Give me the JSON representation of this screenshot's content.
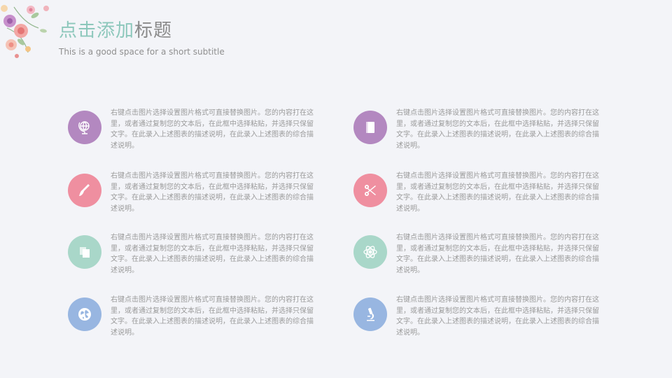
{
  "header": {
    "title_accent": "点击添加",
    "title_rest": "标题",
    "subtitle": "This is a good space for a short subtitle"
  },
  "colors": {
    "purple": "#b388c0",
    "pink": "#ef8fa0",
    "mint": "#a9d7c9",
    "blue": "#98b6e1",
    "title_accent": "#8cc7bb",
    "text": "#9a9a9a"
  },
  "items": [
    {
      "icon": "globe-stand-icon",
      "color": "purple",
      "text": "右键点击图片选择设置图片格式可直接替换图片。您的内容打在这里，或者通过复制您的文本后，在此框中选择粘贴，并选择只保留文字。在此录入上述图表的描述说明，在此录入上述图表的综合描述说明。"
    },
    {
      "icon": "book-icon",
      "color": "purple",
      "text": "右键点击图片选择设置图片格式可直接替换图片。您的内容打在这里，或者通过复制您的文本后，在此框中选择粘贴，并选择只保留文字。在此录入上述图表的描述说明，在此录入上述图表的综合描述说明。"
    },
    {
      "icon": "brush-icon",
      "color": "pink",
      "text": "右键点击图片选择设置图片格式可直接替换图片。您的内容打在这里，或者通过复制您的文本后，在此框中选择粘贴，并选择只保留文字。在此录入上述图表的描述说明，在此录入上述图表的综合描述说明。"
    },
    {
      "icon": "scissors-icon",
      "color": "pink",
      "text": "右键点击图片选择设置图片格式可直接替换图片。您的内容打在这里，或者通过复制您的文本后，在此框中选择粘贴，并选择只保留文字。在此录入上述图表的描述说明，在此录入上述图表的综合描述说明。"
    },
    {
      "icon": "documents-icon",
      "color": "mint",
      "text": "右键点击图片选择设置图片格式可直接替换图片。您的内容打在这里，或者通过复制您的文本后，在此框中选择粘贴，并选择只保留文字。在此录入上述图表的描述说明，在此录入上述图表的综合描述说明。"
    },
    {
      "icon": "atom-icon",
      "color": "mint",
      "text": "右键点击图片选择设置图片格式可直接替换图片。您的内容打在这里，或者通过复制您的文本后，在此框中选择粘贴，并选择只保留文字。在此录入上述图表的描述说明，在此录入上述图表的综合描述说明。"
    },
    {
      "icon": "earth-icon",
      "color": "blue",
      "text": "右键点击图片选择设置图片格式可直接替换图片。您的内容打在这里，或者通过复制您的文本后，在此框中选择粘贴，并选择只保留文字。在此录入上述图表的描述说明，在此录入上述图表的综合描述说明。"
    },
    {
      "icon": "microscope-icon",
      "color": "blue",
      "text": "右键点击图片选择设置图片格式可直接替换图片。您的内容打在这里，或者通过复制您的文本后，在此框中选择粘贴，并选择只保留文字。在此录入上述图表的描述说明，在此录入上述图表的综合描述说明。"
    }
  ]
}
